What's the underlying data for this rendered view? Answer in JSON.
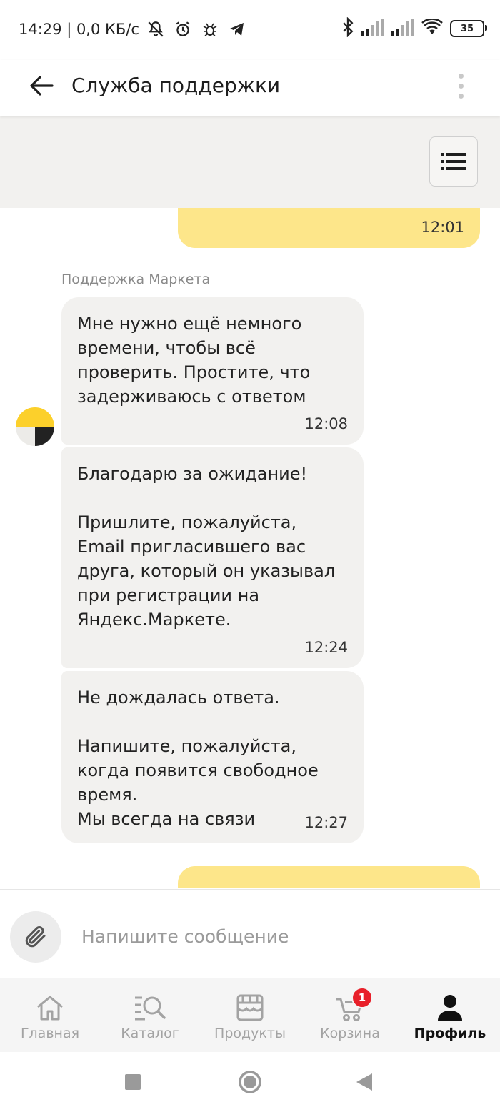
{
  "status_bar": {
    "time_net": "14:29 | 0,0 КБ/с",
    "battery": "35"
  },
  "header": {
    "title": "Служба поддержки"
  },
  "messages": {
    "own_1": {
      "time": "12:01"
    },
    "sender": "Поддержка Маркета",
    "support_1": {
      "text": "Мне нужно ещё немного времени, чтобы всё проверить. Простите, что задерживаюсь с ответом",
      "time": "12:08"
    },
    "support_2": {
      "text": "Благодарю за ожидание!\n\nПришлите, пожалуйста, Email пригласившего вас друга, который он указывал при регистрации на Яндекс.Маркете.",
      "time": "12:24"
    },
    "support_3": {
      "text": "Не дождалась ответа.\n\nНапишите, пожалуйста, когда появится свободное время.\nМы всегда на связи",
      "time": "12:27"
    }
  },
  "composer": {
    "placeholder": "Напишите сообщение"
  },
  "bottom_nav": {
    "items": [
      {
        "label": "Главная",
        "icon": "home-icon"
      },
      {
        "label": "Каталог",
        "icon": "catalog-search-icon"
      },
      {
        "label": "Продукты",
        "icon": "store-icon"
      },
      {
        "label": "Корзина",
        "icon": "cart-icon",
        "badge": "1"
      },
      {
        "label": "Профиль",
        "icon": "profile-icon",
        "active": true
      }
    ]
  },
  "colors": {
    "own_bubble": "#fde68a",
    "support_bubble": "#f2f1ef",
    "badge": "#e8202a",
    "avatar_yellow": "#fcd02b"
  }
}
